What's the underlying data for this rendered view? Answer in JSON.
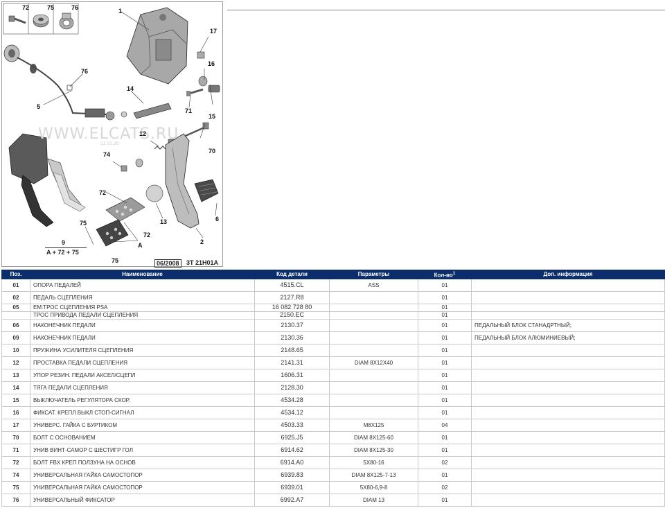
{
  "diagram": {
    "watermark": "WWW.ELCATS.RU",
    "watermark_date": "11.01.20",
    "date_stamp": "06/2008",
    "diagram_code": "3T 21H01A",
    "formula_label": "9",
    "formula": "A + 72 + 75",
    "callouts": {
      "c1": "1",
      "c2": "2",
      "c5": "5",
      "c6": "6",
      "c12": "12",
      "c13": "13",
      "c14": "14",
      "c15": "15",
      "c16": "16",
      "c17": "17",
      "c70": "70",
      "c71": "71",
      "c72a": "72",
      "c72b": "72",
      "c72c": "72",
      "c74": "74",
      "c75a": "75",
      "c75b": "75",
      "c75c": "75",
      "c76a": "76",
      "c76b": "76",
      "cA": "A"
    }
  },
  "table": {
    "headers": {
      "pos": "Поз.",
      "name": "Наименование",
      "code": "Код детали",
      "params": "Параметры",
      "qty": "Кол-во",
      "info": "Доп. информация"
    },
    "qty_marker": "1",
    "rows": [
      {
        "pos": "01",
        "name": "ОПОРА ПЕДАЛЕЙ",
        "code": "4515.CL",
        "params": "ASS",
        "qty": "01",
        "info": ""
      },
      {
        "pos": "02",
        "name": "ПЕДАЛЬ СЦЕПЛЕНИЯ",
        "code": "2127.R8",
        "params": "",
        "qty": "01",
        "info": ""
      },
      {
        "pos": "05",
        "name": "EM:ТРОС СЦЕПЛЕНИЯ PSA",
        "code": "16 082 728 80",
        "params": "",
        "qty": "01",
        "info": ""
      },
      {
        "pos": "",
        "name": "ТРОС ПРИВОДА ПЕДАЛИ СЦЕПЛЕНИЯ",
        "code": "2150.EC",
        "params": "",
        "qty": "01",
        "info": ""
      },
      {
        "pos": "06",
        "name": "НАКОНЕЧНИК ПЕДАЛИ",
        "code": "2130.37",
        "params": "",
        "qty": "01",
        "info": "ПЕДАЛЬНЫЙ БЛОК СТАНАДРТНЫЙ;"
      },
      {
        "pos": "09",
        "name": "НАКОНЕЧНИК ПЕДАЛИ",
        "code": "2130.36",
        "params": "",
        "qty": "01",
        "info": "ПЕДАЛЬНЫЙ БЛОК АЛЮМИНИЕВЫЙ;"
      },
      {
        "pos": "10",
        "name": "ПРУЖИНА УСИЛИТЕЛЯ СЦЕПЛЕНИЯ",
        "code": "2148.65",
        "params": "",
        "qty": "01",
        "info": ""
      },
      {
        "pos": "12",
        "name": "ПРОСТАВКА ПЕДАЛИ СЦЕПЛЕНИЯ",
        "code": "2141.31",
        "params": "DIAM 8X12X40",
        "qty": "01",
        "info": ""
      },
      {
        "pos": "13",
        "name": "УПОР РЕЗИН. ПЕДАЛИ АКСЕЛ/СЦЕПЛ",
        "code": "1606.31",
        "params": "",
        "qty": "01",
        "info": ""
      },
      {
        "pos": "14",
        "name": "ТЯГА ПЕДАЛИ СЦЕПЛЕНИЯ",
        "code": "2128.30",
        "params": "",
        "qty": "01",
        "info": ""
      },
      {
        "pos": "15",
        "name": "ВЫКЛЮЧАТЕЛЬ РЕГУЛЯТОРА СКОР.",
        "code": "4534.28",
        "params": "",
        "qty": "01",
        "info": ""
      },
      {
        "pos": "16",
        "name": "ФИКСАТ. КРЕПЛ ВЫКЛ СТОП-СИГНАЛ",
        "code": "4534.12",
        "params": "",
        "qty": "01",
        "info": ""
      },
      {
        "pos": "17",
        "name": "УНИВЕРС. ГАЙКА С БУРТИКОМ",
        "code": "4503.33",
        "params": "M8X125",
        "qty": "04",
        "info": ""
      },
      {
        "pos": "70",
        "name": "БОЛТ С ОСНОВАНИЕМ",
        "code": "6925.J5",
        "params": "DIAM 8X125-60",
        "qty": "01",
        "info": ""
      },
      {
        "pos": "71",
        "name": "УНИВ ВИНТ-САМОР С ШЕСТИГР ГОЛ",
        "code": "6914.62",
        "params": "DIAM 8X125-30",
        "qty": "01",
        "info": ""
      },
      {
        "pos": "72",
        "name": "БОЛТ FBX КРЕП ПОЛЗУНА НА ОСНОВ",
        "code": "6914.A0",
        "params": "5X80-16",
        "qty": "02",
        "info": ""
      },
      {
        "pos": "74",
        "name": "УНИВЕРСАЛЬНАЯ ГАЙКА САМОСТОПОР",
        "code": "6939.83",
        "params": "DIAM 8X125-7-13",
        "qty": "01",
        "info": ""
      },
      {
        "pos": "75",
        "name": "УНИВЕРСАЛЬНАЯ ГАЙКА САМОСТОПОР",
        "code": "6939.01",
        "params": "5X80-6,9-8",
        "qty": "02",
        "info": ""
      },
      {
        "pos": "76",
        "name": "УНИВЕРСАЛЬНЫЙ ФИКСАТОР",
        "code": "6992.A7",
        "params": "DIAM 13",
        "qty": "01",
        "info": ""
      }
    ]
  }
}
